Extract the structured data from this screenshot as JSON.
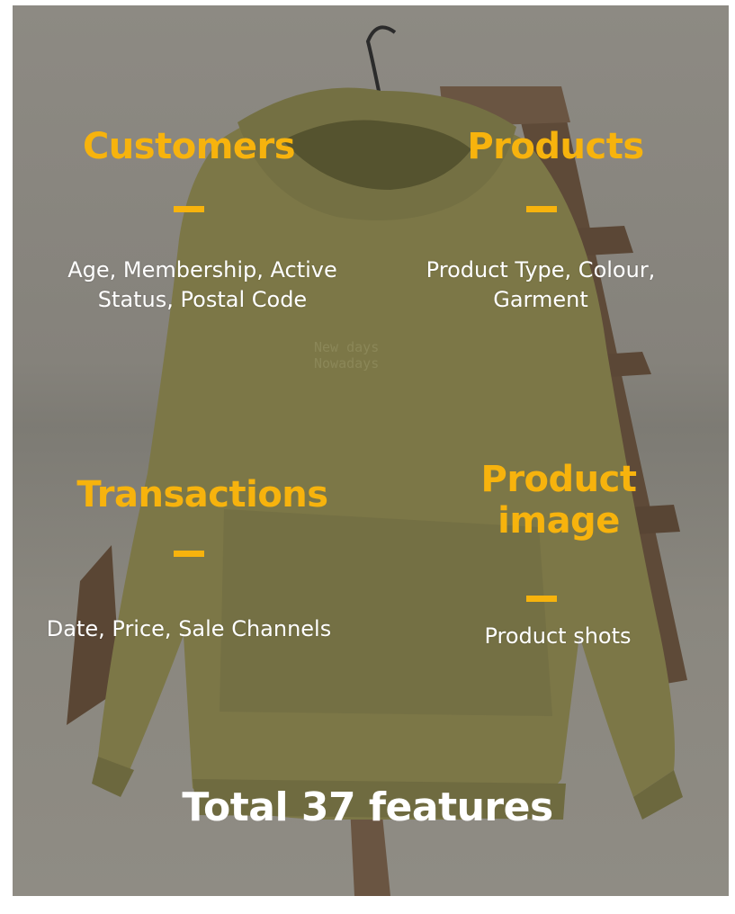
{
  "sections": {
    "customers": {
      "title": "Customers",
      "description": "Age, Membership, Active Status, Postal Code"
    },
    "products": {
      "title": "Products",
      "description": "Product Type, Colour, Garment"
    },
    "transactions": {
      "title": "Transactions",
      "description": "Date, Price, Sale Channels"
    },
    "product_image": {
      "title_line1": "Product",
      "title_line2": "image",
      "description": "Product shots"
    }
  },
  "total": "Total 37 features",
  "hoodie_print": {
    "line1": "New  days",
    "line2": "Nowadays"
  },
  "colors": {
    "accent": "#f7b30d",
    "text": "#ffffff",
    "hoodie": "#7c7747",
    "background": "#8b8880"
  },
  "background_image": "olive hoodie on wooden hanger and ladder"
}
